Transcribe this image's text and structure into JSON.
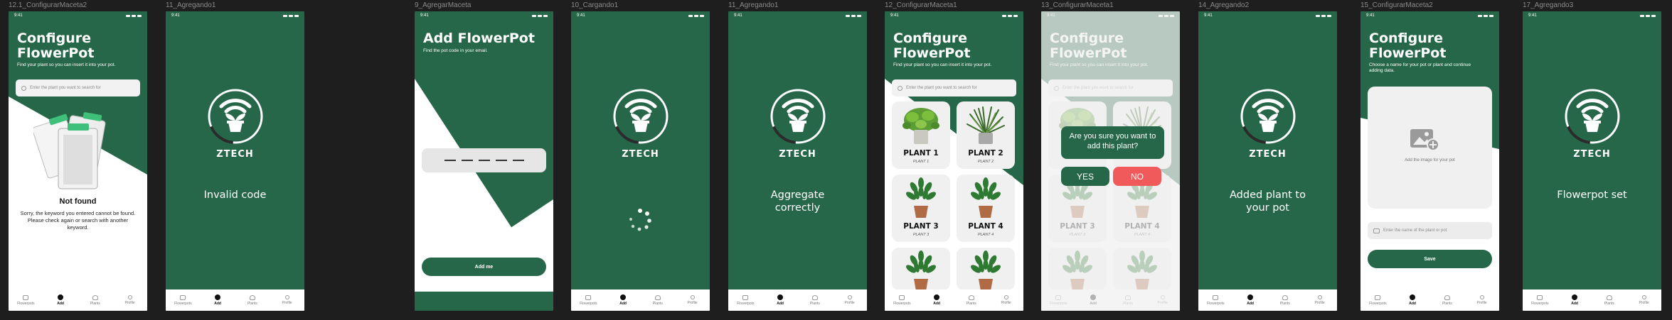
{
  "frames": [
    {
      "label": "12.1_ConfigurarMaceta2"
    },
    {
      "label": "11_Agregando1"
    },
    {
      "label": "9_AgregarMaceta"
    },
    {
      "label": "10_Cargando1"
    },
    {
      "label": "11_Agregando1"
    },
    {
      "label": "12_ConfigurarMaceta1"
    },
    {
      "label": "13_ConfigurarMaceta1"
    },
    {
      "label": "14_Agregando2"
    },
    {
      "label": "15_ConfigurarMaceta2"
    },
    {
      "label": "17_Agregando3"
    }
  ],
  "status_time": "9:41",
  "brand": "ZTECH",
  "nav": [
    "Flowerpots",
    "Add",
    "Plants",
    "Profile"
  ],
  "configure": {
    "title": "Configure FlowerPot",
    "subtitle": "Find your plant so you can insert it into your pot.",
    "search_placeholder": "Enter the plant you want to search for"
  },
  "not_found": {
    "title": "Not found",
    "body": "Sorry, the keyword you entered cannot be found. Please check again or search with another keyword."
  },
  "invalid_code": "Invalid code",
  "add_flowerpot": {
    "title": "Add FlowerPot",
    "subtitle": "Find the pot code in your email.",
    "button": "Add me"
  },
  "aggregate": "Aggregate correctly",
  "plants": [
    {
      "name": "PLANT 1",
      "sub": "PLANT 1"
    },
    {
      "name": "PLANT 2",
      "sub": "PLANT 2"
    },
    {
      "name": "PLANT 3",
      "sub": "PLANT 3"
    },
    {
      "name": "PLANT 4",
      "sub": "PLANT 4"
    }
  ],
  "confirm": {
    "question": "Are you sure you want to add this plant?",
    "yes": "YES",
    "no": "NO"
  },
  "added": "Added plant to your pot",
  "name_screen": {
    "title": "Configure FlowerPot",
    "subtitle": "Choose a name for your pot or plant and continue adding data.",
    "image_hint": "Add the image for your pot",
    "name_placeholder": "Enter the name of the plant or pot",
    "save": "Save"
  },
  "flowerpot_set": "Flowerpot set",
  "colors": {
    "brand_green": "#276749",
    "no_red": "#f05a5a",
    "card": "#f0f0f0"
  }
}
